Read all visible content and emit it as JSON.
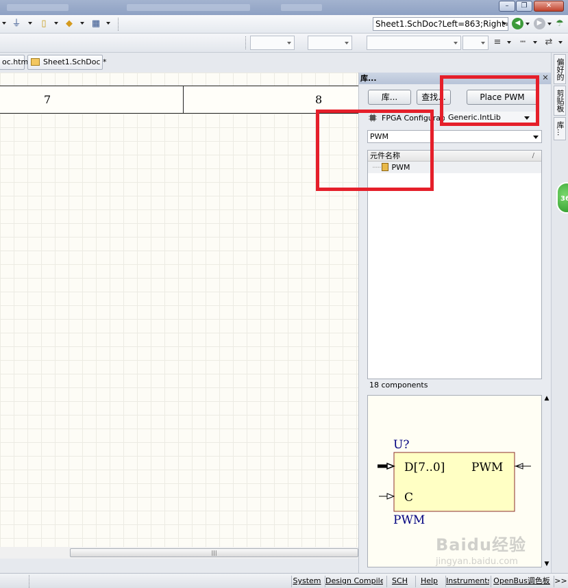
{
  "address_bar": {
    "value": "Sheet1.SchDoc?Left=863;Right="
  },
  "doc_tabs": [
    {
      "label": "oc.htm"
    },
    {
      "label": "Sheet1.SchDoc *"
    }
  ],
  "sheet": {
    "zone_left": "7",
    "zone_right": "8"
  },
  "libraries_panel": {
    "title": "库...",
    "libraries_button": "库...",
    "search_button": "查找...",
    "place_button": "Place PWM",
    "library_type_label": "FPGA Configurab",
    "selected_library": "Generic.IntLib",
    "filter_value": "PWM",
    "column_header": "元件名称",
    "items": [
      {
        "name": "PWM"
      }
    ],
    "count": "18 components",
    "preview": {
      "designator": "U?",
      "pin_d": "D[7..0]",
      "pin_c": "C",
      "output_pin": "PWM",
      "component_name": "PWM"
    }
  },
  "right_dock_tabs": [
    "偏好的",
    "剪贴板",
    "库..."
  ],
  "notification_badge": "36",
  "status_bar": {
    "buttons": [
      "System",
      "Design Compiler",
      "SCH",
      "Help",
      "Instruments",
      "OpenBus调色板",
      ">>"
    ]
  },
  "watermark": {
    "brand": "Baidu经验",
    "url": "jingyan.baidu.com"
  },
  "colors": {
    "highlight": "#e51f2a",
    "component_fill": "#ffffc4",
    "component_text": "#000080"
  },
  "icons": [
    "power-ground-icon",
    "pin-icon",
    "net-label-icon",
    "grid-icon",
    "back-icon",
    "forward-icon",
    "umbrella-icon"
  ]
}
